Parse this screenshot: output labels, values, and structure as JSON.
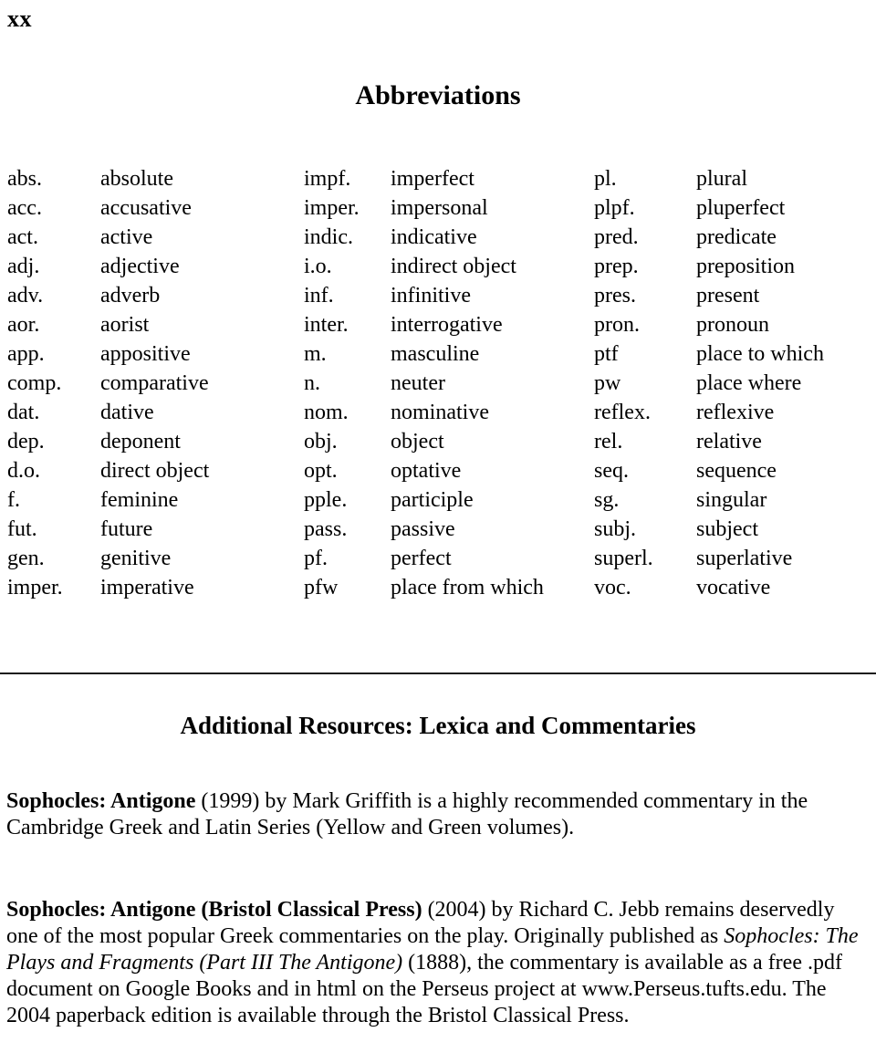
{
  "page": {
    "folio": "xx",
    "section_title": "Abbreviations",
    "resources_heading": "Additional Resources: Lexica and Commentaries"
  },
  "abbreviations": {
    "column_1": [
      {
        "abbr": "abs.",
        "meaning": "absolute"
      },
      {
        "abbr": "acc.",
        "meaning": "accusative"
      },
      {
        "abbr": "act.",
        "meaning": "active"
      },
      {
        "abbr": "adj.",
        "meaning": "adjective"
      },
      {
        "abbr": "adv.",
        "meaning": "adverb"
      },
      {
        "abbr": "aor.",
        "meaning": "aorist"
      },
      {
        "abbr": "app.",
        "meaning": "appositive"
      },
      {
        "abbr": "comp.",
        "meaning": "comparative"
      },
      {
        "abbr": "dat.",
        "meaning": "dative"
      },
      {
        "abbr": "dep.",
        "meaning": "deponent"
      },
      {
        "abbr": "d.o.",
        "meaning": "direct object"
      },
      {
        "abbr": "f.",
        "meaning": "feminine"
      },
      {
        "abbr": "fut.",
        "meaning": "future"
      },
      {
        "abbr": "gen.",
        "meaning": "genitive"
      },
      {
        "abbr": "imper.",
        "meaning": "imperative"
      }
    ],
    "column_2": [
      {
        "abbr": "impf.",
        "meaning": "imperfect"
      },
      {
        "abbr": "imper.",
        "meaning": "impersonal"
      },
      {
        "abbr": "indic.",
        "meaning": "indicative"
      },
      {
        "abbr": "i.o.",
        "meaning": "indirect object"
      },
      {
        "abbr": "inf.",
        "meaning": "infinitive"
      },
      {
        "abbr": "inter.",
        "meaning": "interrogative"
      },
      {
        "abbr": "m.",
        "meaning": "masculine"
      },
      {
        "abbr": "n.",
        "meaning": "neuter"
      },
      {
        "abbr": "nom.",
        "meaning": "nominative"
      },
      {
        "abbr": "obj.",
        "meaning": "object"
      },
      {
        "abbr": "opt.",
        "meaning": "optative"
      },
      {
        "abbr": "pple.",
        "meaning": "participle"
      },
      {
        "abbr": "pass.",
        "meaning": "passive"
      },
      {
        "abbr": "pf.",
        "meaning": "perfect"
      },
      {
        "abbr": "pfw",
        "meaning": "place from which"
      }
    ],
    "column_3": [
      {
        "abbr": "pl.",
        "meaning": "plural"
      },
      {
        "abbr": "plpf.",
        "meaning": "pluperfect"
      },
      {
        "abbr": "pred.",
        "meaning": "predicate"
      },
      {
        "abbr": "prep.",
        "meaning": "preposition"
      },
      {
        "abbr": "pres.",
        "meaning": "present"
      },
      {
        "abbr": "pron.",
        "meaning": "pronoun"
      },
      {
        "abbr": "ptf",
        "meaning": "place to which"
      },
      {
        "abbr": "pw",
        "meaning": "place where"
      },
      {
        "abbr": "reflex.",
        "meaning": "reflexive"
      },
      {
        "abbr": "rel.",
        "meaning": "relative"
      },
      {
        "abbr": "seq.",
        "meaning": "sequence"
      },
      {
        "abbr": "sg.",
        "meaning": "singular"
      },
      {
        "abbr": "subj.",
        "meaning": "subject"
      },
      {
        "abbr": "superl.",
        "meaning": "superlative"
      },
      {
        "abbr": "voc.",
        "meaning": "vocative"
      }
    ]
  },
  "resources": {
    "entry_1": {
      "title_bold": "Sophocles: Antigone",
      "rest": " (1999) by Mark Griffith is a highly recommended commentary in the Cambridge Greek and Latin Series (Yellow and Green volumes)."
    },
    "entry_2": {
      "title_bold": "Sophocles: Antigone (Bristol Classical Press)",
      "segment_1": " (2004) by Richard C. Jebb remains deservedly one of the most popular Greek commentaries on the play. Originally published as ",
      "title_italic": "Sophocles: The Plays and Fragments (Part III The Antigone)",
      "segment_2": " (1888), the commentary is available as a free .pdf document on Google Books and in html on the Perseus project at www.Perseus.tufts.edu. The 2004 paperback edition is available through the Bristol Classical Press."
    }
  }
}
